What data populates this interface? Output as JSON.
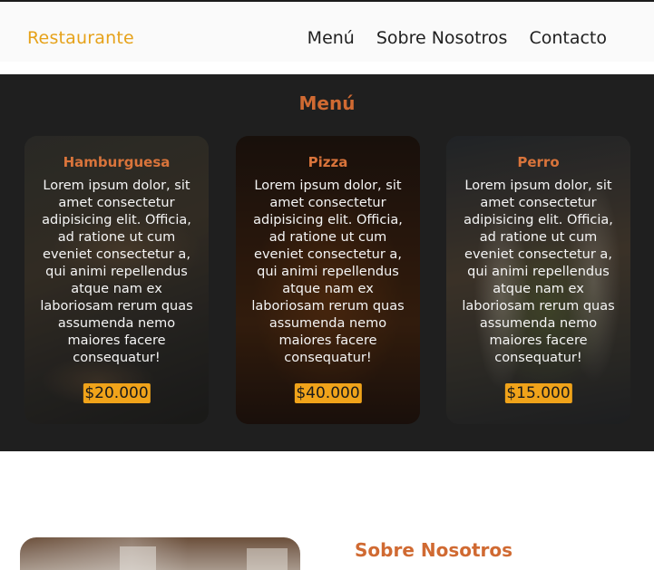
{
  "header": {
    "brand": "Restaurante",
    "nav": [
      "Menú",
      "Sobre Nosotros",
      "Contacto"
    ]
  },
  "menu": {
    "title": "Menú",
    "items": [
      {
        "name": "Hamburguesa",
        "description": "Lorem ipsum dolor, sit amet consectetur adipisicing elit. Officia, ad ratione ut cum eveniet consectetur a, qui animi repellendus atque nam ex laboriosam rerum quas assumenda nemo maiores facere consequatur!",
        "price": "$20.000"
      },
      {
        "name": "Pizza",
        "description": "Lorem ipsum dolor, sit amet consectetur adipisicing elit. Officia, ad ratione ut cum eveniet consectetur a, qui animi repellendus atque nam ex laboriosam rerum quas assumenda nemo maiores facere consequatur!",
        "price": "$40.000"
      },
      {
        "name": "Perro",
        "description": "Lorem ipsum dolor, sit amet consectetur adipisicing elit. Officia, ad ratione ut cum eveniet consectetur a, qui animi repellendus atque nam ex laboriosam rerum quas assumenda nemo maiores facere consequatur!",
        "price": "$15.000"
      }
    ]
  },
  "about": {
    "title": "Sobre Nosotros"
  },
  "colors": {
    "accent": "#d06a32",
    "brand": "#e6a21a",
    "price_bg": "#f0a31a",
    "menu_bg": "#1f1f1f"
  }
}
